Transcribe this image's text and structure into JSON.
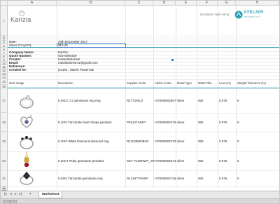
{
  "columns": [
    "A",
    "B",
    "C",
    "D",
    "E",
    "F",
    "G",
    "H"
  ],
  "rows": [
    "1",
    "2",
    "3",
    "4",
    "5",
    "6",
    "7",
    "8",
    "9",
    "10",
    "11",
    "12",
    "13",
    "14",
    "15",
    "16",
    "17",
    "18",
    "19",
    "20",
    "21",
    "22",
    "23"
  ],
  "header": {
    "logo_text": "Karizia",
    "quote_made_using": "Quotation made using",
    "atelier_name": "ATELIER",
    "atelier_sub": "TECHNOLOGY"
  },
  "info": {
    "date_label": "Date:",
    "date_value": "24th December 2017",
    "silver_label": "Silver (Troy/Oz):",
    "silver_value": "$15.45",
    "company_label": "Company Name:",
    "company_value": "Karizia",
    "quote_label": "Quote Number:",
    "quote_value": "003-0000439",
    "creator_label": "Creator:",
    "creator_value": "Ivana Bertonesi",
    "email_label": "Email:",
    "email_value": "mastikutimmm1@gmail.com",
    "reference_label": "Reference:",
    "reference_value": "",
    "created_label": "Created for:",
    "created_value": "jocolar , Marek Pasternak"
  },
  "table": {
    "headers": {
      "item_image": "Item Image",
      "description": "Description",
      "supplier_code": "Supplier Code",
      "atelier_code": "Atelier Code",
      "metal_type": "Metal Type",
      "metal_title": "Metal Title",
      "loss": "Loss (%)",
      "weight_tolerance": "Weight Tolerance (%)"
    },
    "rows": [
      {
        "description": "0.26CC Cz gemstone ring ring",
        "supplier": "R1771WC2",
        "atelier": "AT0000002907",
        "metal": "silver",
        "title": "925",
        "loss": "0.075",
        "tol": "5"
      },
      {
        "description": "0.10Ct Tanzanite heart shape pendant",
        "supplier": "P52127ANKT",
        "atelier": "AT0000002476",
        "metal": "silver",
        "title": "925",
        "loss": "0.075",
        "tol": "5"
      },
      {
        "description": "0.10Ct White Diamond diamond ring",
        "supplier": "R11138WDBLD",
        "atelier": "AT0000002723",
        "metal": "silver",
        "title": "925",
        "loss": "0.075",
        "tol": "5"
      },
      {
        "description": "0.20CT Ruby gemstone pendant",
        "supplier": "SET P14NRWT_SP",
        "atelier": "AT0000002573",
        "metal": "silver",
        "title": "925",
        "loss": "0.075",
        "tol": "5"
      },
      {
        "description": "0.49Ct Tanzanite gemstone ring",
        "supplier": "R12167TANSP",
        "atelier": "AT0000002726",
        "metal": "silver",
        "title": "925",
        "loss": "0.075",
        "tol": "5"
      }
    ]
  },
  "sheet_tabs": [
    "Worksheet"
  ],
  "add_sheet": "+"
}
